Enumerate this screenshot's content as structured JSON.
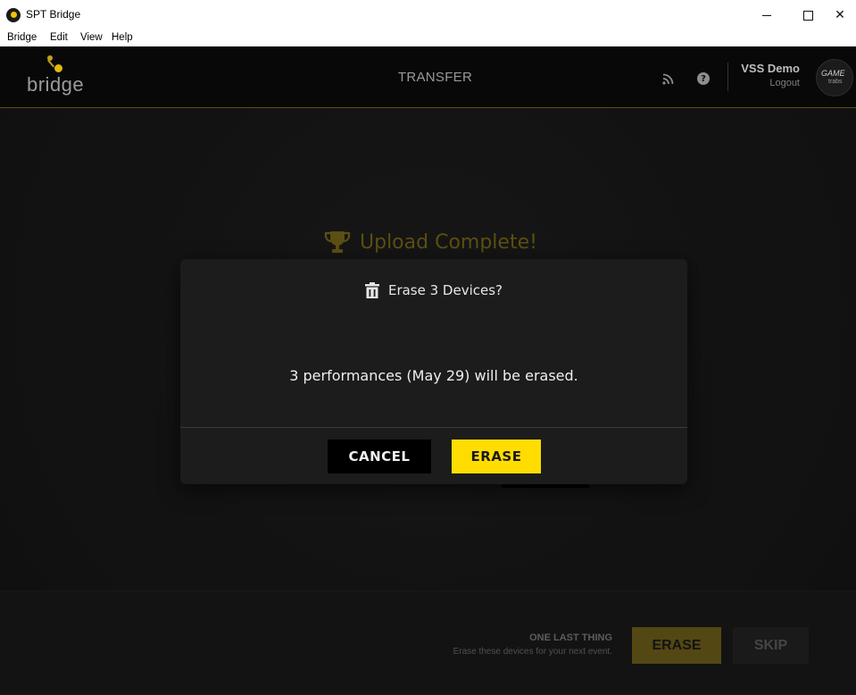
{
  "window": {
    "title": "SPT Bridge",
    "controls": {
      "minimize": "",
      "maximize": "",
      "close": "✕"
    }
  },
  "menu": [
    "Bridge",
    "Edit",
    "View",
    "Help"
  ],
  "header": {
    "logo_text": "bridge",
    "title": "TRANSFER",
    "user_name": "VSS Demo",
    "logout_label": "Logout",
    "help_glyph": "?",
    "avatar_text": "GAME",
    "avatar_subtext": "trabs"
  },
  "background": {
    "status": "Upload Complete!"
  },
  "modal": {
    "title": "Erase 3 Devices?",
    "message": "3 performances (May 29) will be erased.",
    "cancel_label": "CANCEL",
    "erase_label": "ERASE"
  },
  "footer": {
    "title": "ONE LAST THING",
    "description": "Erase these devices for your next event.",
    "erase_label": "ERASE",
    "skip_label": "SKIP"
  },
  "colors": {
    "accent": "#ffdd00",
    "accent_dim": "#6f5f1a",
    "header_bg": "#080808",
    "body_bg": "#1d1d1d"
  }
}
